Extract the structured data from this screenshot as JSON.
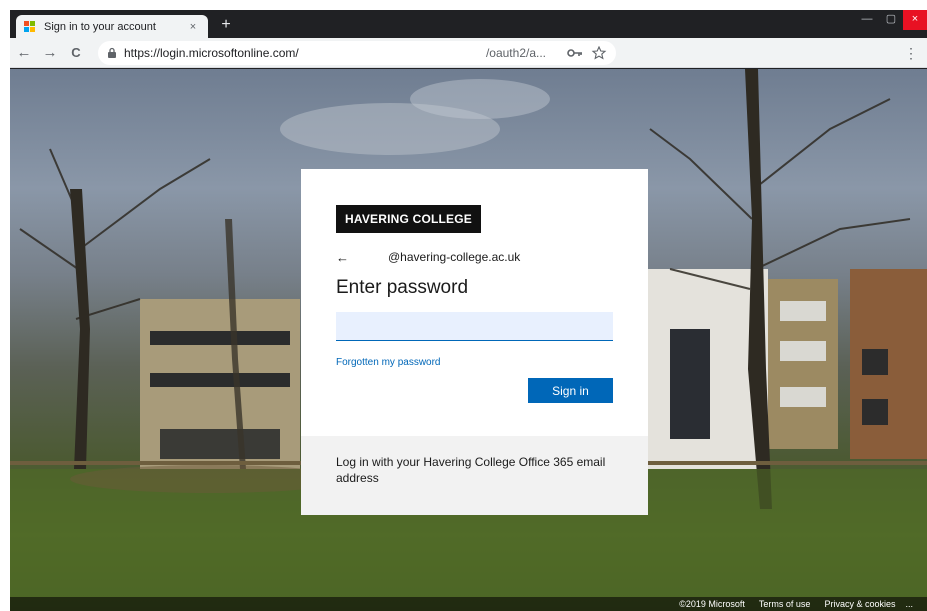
{
  "tab": {
    "title": "Sign in to your account",
    "close": "×",
    "new_tab": "+"
  },
  "window": {
    "minimize": "—",
    "maximize": "▢",
    "close": "×"
  },
  "toolbar": {
    "back": "←",
    "forward": "→",
    "reload": "C",
    "url": "https://login.microsoftonline.com/",
    "url_tail": "/oauth2/a...",
    "menu": "⋮"
  },
  "card": {
    "brand": "HAVERING COLLEGE",
    "back_arrow": "←",
    "email": "@havering-college.ac.uk",
    "heading": "Enter password",
    "password_value": "",
    "forgot_link": "Forgotten my password",
    "signin_label": "Sign in",
    "footer_text": "Log in with your Havering College Office 365 email address"
  },
  "footer": {
    "copyright": "©2019 Microsoft",
    "terms": "Terms of use",
    "privacy": "Privacy & cookies",
    "more": "..."
  },
  "colors": {
    "accent": "#0067b8",
    "ms_red": "#f25022",
    "ms_green": "#7fba00",
    "ms_blue": "#00a4ef",
    "ms_yellow": "#ffb900"
  }
}
